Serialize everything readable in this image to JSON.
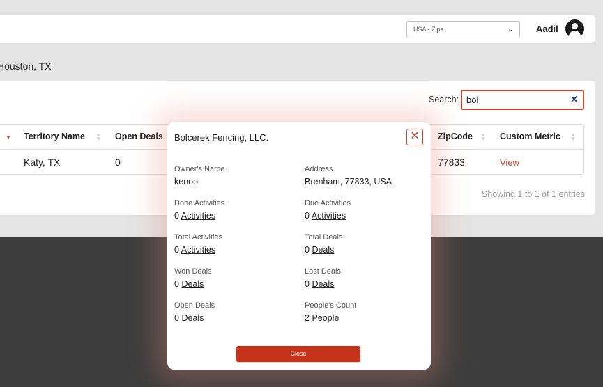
{
  "header": {
    "region_select": "USA - Zips",
    "username": "Aadil"
  },
  "breadcrumb": "Houston, TX",
  "search": {
    "label": "Search:",
    "value": "bol"
  },
  "table": {
    "headers": [
      "Territory Name",
      "Open Deals",
      "ZipCode",
      "Custom Metric"
    ],
    "row": {
      "territory": "Katy, TX",
      "open_deals": "0",
      "zipcode": "77833",
      "custom_metric": "View"
    },
    "entries_info": "Showing 1 to 1 of 1 entries"
  },
  "modal": {
    "title": "Bolcerek Fencing, LLC.",
    "owner_label": "Owner's Name",
    "owner_value": "kenoo",
    "address_label": "Address",
    "address_value": "Brenham, 77833, USA",
    "done_label": "Done Activities",
    "done_count": "0",
    "done_link": "Activities",
    "due_label": "Due Activities",
    "due_count": "0",
    "due_link": "Activities",
    "total_act_label": "Total Activities",
    "total_act_count": "0",
    "total_act_link": "Activities",
    "total_deals_label": "Total Deals",
    "total_deals_count": "0",
    "total_deals_link": "Deals",
    "won_label": "Won Deals",
    "won_count": "0",
    "won_link": "Deals",
    "lost_label": "Lost Deals",
    "lost_count": "0",
    "lost_link": "Deals",
    "open_label": "Open Deals",
    "open_count": "0",
    "open_link": "Deals",
    "people_label": "People's Count",
    "people_count": "2",
    "people_link": "People",
    "close_label": "Close"
  },
  "colors": {
    "accent": "#c8472e",
    "close_button": "#c4331a",
    "dark_overlay": "#3d3d3d"
  }
}
